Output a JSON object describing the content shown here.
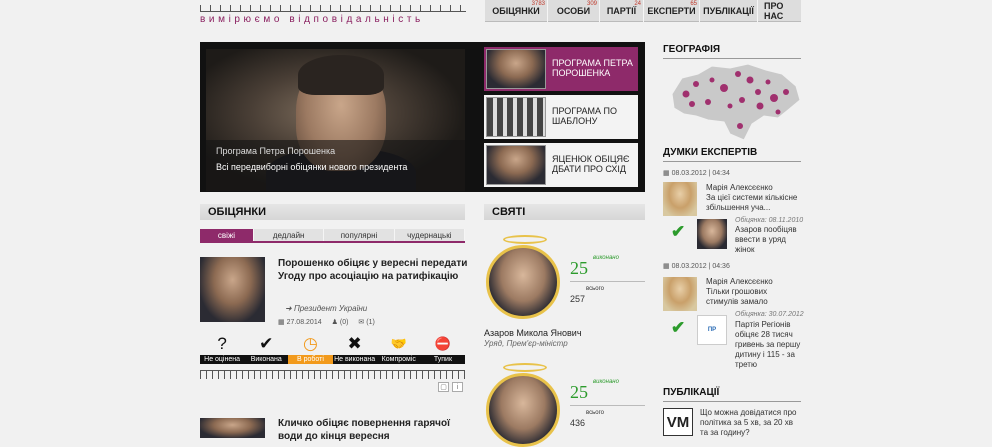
{
  "header": {
    "tagline": "вимірюємо відповідальність",
    "nav": [
      {
        "label": "Обіцянки",
        "count": "3783"
      },
      {
        "label": "Особи",
        "count": "309"
      },
      {
        "label": "Партії",
        "count": "24"
      },
      {
        "label": "Експерти",
        "count": "65"
      },
      {
        "label": "Публікації",
        "count": ""
      },
      {
        "label": "Про нас",
        "count": ""
      }
    ]
  },
  "hero": {
    "caption_title": "Програма Петра Порошенка",
    "caption_sub": "Всі передвиборні обіцянки нового президента",
    "items": [
      {
        "label": "Програма Петра Порошенка"
      },
      {
        "label": "Програма по шаблону"
      },
      {
        "label": "Яценюк обіцяє дбати про схід"
      }
    ]
  },
  "promises": {
    "heading": "Обіцянки",
    "tabs": [
      "свіжі",
      "дедлайн",
      "популярні",
      "чудернацькі"
    ],
    "first": {
      "title": "Порошенко обіцяє у вересні передати Угоду про асоціацію на ратифікацію",
      "author": "Президент України",
      "date": "27.08.2014",
      "votes": "(0)",
      "comments": "(1)"
    },
    "statuses": [
      {
        "label": "Не оцінена",
        "icon": "?"
      },
      {
        "label": "Виконана",
        "icon": "✔"
      },
      {
        "label": "В роботі",
        "icon": "◷"
      },
      {
        "label": "Не виконана",
        "icon": "✖"
      },
      {
        "label": "Компроміс",
        "icon": "🤝"
      },
      {
        "label": "Тупик",
        "icon": "⛔"
      }
    ],
    "second": {
      "title": "Кличко обіцяє повернення гарячої води до кінця вересня"
    }
  },
  "saints": {
    "heading": "Святі",
    "list": [
      {
        "num": "25",
        "done_label": "виконано",
        "count": "257",
        "all_label": "всього",
        "name": "Азаров Микола Янович",
        "role": "Уряд, Прем'єр-міністр"
      },
      {
        "num": "25",
        "done_label": "виконано",
        "count": "436",
        "all_label": "всього"
      }
    ]
  },
  "geo": {
    "heading": "Географія"
  },
  "experts": {
    "heading": "Думки експертів",
    "entries": [
      {
        "date": "08.03.2012 | 04:34",
        "name": "Марія Алексєєнко",
        "text": "За цієї системи кількісне збільшення уча...",
        "src": "Обіцянка: 08.11.2010",
        "promise": "Азаров пообіцяв ввести в уряд жінок"
      },
      {
        "date": "08.03.2012 | 04:36",
        "name": "Марія Алексєєнко",
        "text": "Тільки грошових стимулів замало",
        "src": "Обіцянка: 30.07.2012",
        "promise": "Партія Регіонів обіцяє 28 тисяч гривень за першу дитину і 115 - за третю"
      }
    ]
  },
  "publications": {
    "heading": "Публікації",
    "first": "Що можна довідатися про політика за 5 хв, за 20 хв та за годину?",
    "logo": "VM"
  }
}
